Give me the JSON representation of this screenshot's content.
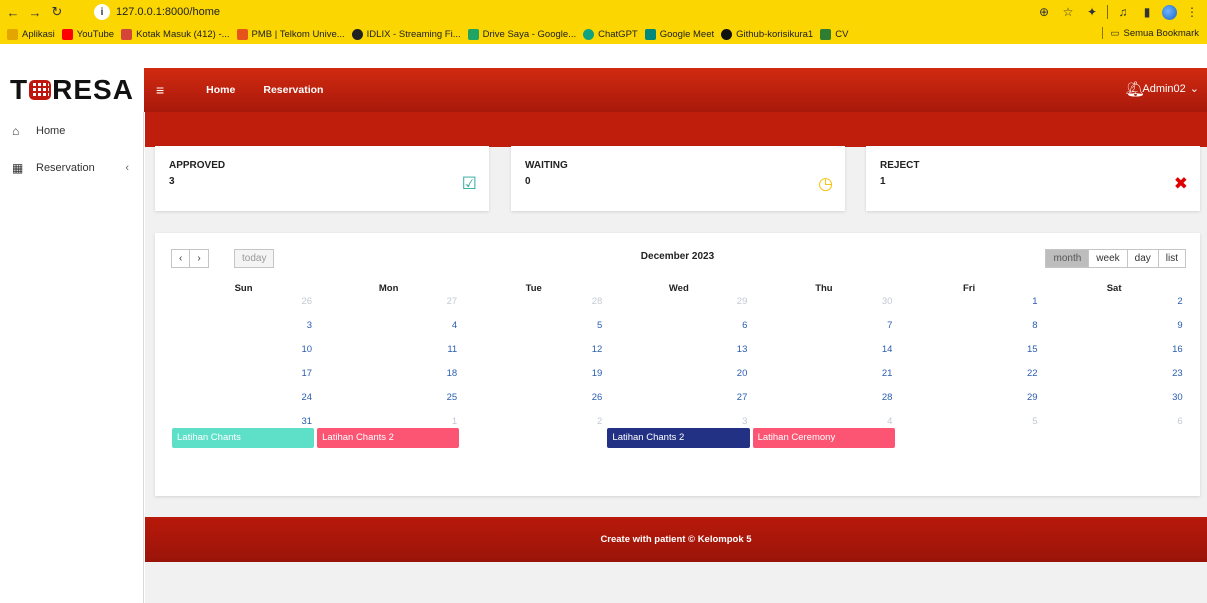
{
  "browser": {
    "url": "127.0.0.1:8000/home",
    "bookmarks": [
      {
        "label": "Aplikasi",
        "color": "#e3a500"
      },
      {
        "label": "YouTube",
        "color": "#ff0000"
      },
      {
        "label": "Kotak Masuk (412) -...",
        "color": "#d44638"
      },
      {
        "label": "PMB | Telkom Unive...",
        "color": "#e5541b"
      },
      {
        "label": "IDLIX - Streaming Fi...",
        "color": "#222222"
      },
      {
        "label": "Drive Saya - Google...",
        "color": "#1fa463"
      },
      {
        "label": "ChatGPT",
        "color": "#10a37f"
      },
      {
        "label": "Google Meet",
        "color": "#00897b"
      },
      {
        "label": "Github-korisikura1",
        "color": "#111111"
      },
      {
        "label": "CV",
        "color": "#2e7d32"
      }
    ],
    "all_bookmarks": "Semua Bookmark"
  },
  "app": {
    "logo_left": "T",
    "logo_right": "RESA",
    "nav": {
      "home": "Home",
      "reservation": "Reservation"
    },
    "user": "Admin02",
    "accent": "#c01e0c"
  },
  "sidebar": {
    "items": [
      {
        "label": "Home",
        "icon": "home-icon"
      },
      {
        "label": "Reservation",
        "icon": "building-icon"
      }
    ]
  },
  "stats": [
    {
      "label": "APPROVED",
      "value": "3",
      "icon": "check-square-icon",
      "color": "#26a69a"
    },
    {
      "label": "WAITING",
      "value": "0",
      "icon": "clock-icon",
      "color": "#f5c000"
    },
    {
      "label": "REJECT",
      "value": "1",
      "icon": "x-icon",
      "color": "#e00000"
    }
  ],
  "calendar": {
    "title": "December 2023",
    "today": "today",
    "views": [
      "month",
      "week",
      "day",
      "list"
    ],
    "active_view": "month",
    "days_of_week": [
      "Sun",
      "Mon",
      "Tue",
      "Wed",
      "Thu",
      "Fri",
      "Sat"
    ],
    "weeks": [
      [
        {
          "d": "26",
          "o": true
        },
        {
          "d": "27",
          "o": true
        },
        {
          "d": "28",
          "o": true
        },
        {
          "d": "29",
          "o": true
        },
        {
          "d": "30",
          "o": true
        },
        {
          "d": "1",
          "o": false
        },
        {
          "d": "2",
          "o": false
        }
      ],
      [
        {
          "d": "3",
          "o": false
        },
        {
          "d": "4",
          "o": false
        },
        {
          "d": "5",
          "o": false
        },
        {
          "d": "6",
          "o": false
        },
        {
          "d": "7",
          "o": false
        },
        {
          "d": "8",
          "o": false
        },
        {
          "d": "9",
          "o": false
        }
      ],
      [
        {
          "d": "10",
          "o": false
        },
        {
          "d": "11",
          "o": false
        },
        {
          "d": "12",
          "o": false
        },
        {
          "d": "13",
          "o": false
        },
        {
          "d": "14",
          "o": false
        },
        {
          "d": "15",
          "o": false
        },
        {
          "d": "16",
          "o": false
        }
      ],
      [
        {
          "d": "17",
          "o": false
        },
        {
          "d": "18",
          "o": false
        },
        {
          "d": "19",
          "o": false
        },
        {
          "d": "20",
          "o": false
        },
        {
          "d": "21",
          "o": false
        },
        {
          "d": "22",
          "o": false
        },
        {
          "d": "23",
          "o": false
        }
      ],
      [
        {
          "d": "24",
          "o": false
        },
        {
          "d": "25",
          "o": false
        },
        {
          "d": "26",
          "o": false
        },
        {
          "d": "27",
          "o": false
        },
        {
          "d": "28",
          "o": false
        },
        {
          "d": "29",
          "o": false
        },
        {
          "d": "30",
          "o": false
        }
      ],
      [
        {
          "d": "31",
          "o": false
        },
        {
          "d": "1",
          "o": true
        },
        {
          "d": "2",
          "o": true
        },
        {
          "d": "3",
          "o": true
        },
        {
          "d": "4",
          "o": true
        },
        {
          "d": "5",
          "o": true
        },
        {
          "d": "6",
          "o": true
        }
      ]
    ],
    "events": [
      {
        "title": "Latihan Chants",
        "day": 0,
        "color": "#5ee0c8"
      },
      {
        "title": "Latihan Chants 2",
        "day": 1,
        "color": "#fb5573"
      },
      {
        "title": "Latihan Chants 2",
        "day": 3,
        "color": "#233185"
      },
      {
        "title": "Latihan Ceremony",
        "day": 4,
        "color": "#fb5573"
      }
    ]
  },
  "footer": "Create with patient © Kelompok 5"
}
